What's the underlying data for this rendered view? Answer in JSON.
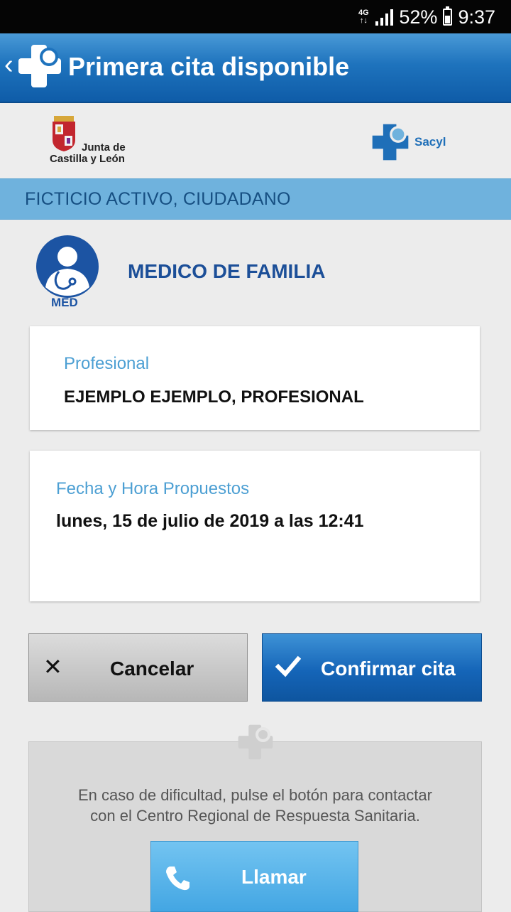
{
  "status_bar": {
    "network_top": "4G",
    "network_bottom": "↑↓",
    "battery_percent": "52%",
    "time": "9:37"
  },
  "app_bar": {
    "title": "Primera cita disponible",
    "back_icon": "chevron-left-icon",
    "logo_icon": "sacyl-cross-icon"
  },
  "logos": {
    "junta_line1": "Junta de",
    "junta_line2": "Castilla y León",
    "sacyl": "Sacyl"
  },
  "user": {
    "name": "FICTICIO ACTIVO, CIUDADANO"
  },
  "service": {
    "icon_label": "MED",
    "title": "MEDICO DE FAMILIA"
  },
  "professional": {
    "label": "Profesional",
    "value": "EJEMPLO EJEMPLO, PROFESIONAL"
  },
  "appointment": {
    "label": "Fecha y Hora Propuestos",
    "value": "lunes, 15 de julio de 2019 a las 12:41"
  },
  "actions": {
    "cancel_label": "Cancelar",
    "confirm_label": "Confirmar cita"
  },
  "help": {
    "line1": "En caso de dificultad, pulse el botón para contactar",
    "line2": "con el Centro Regional de Respuesta Sanitaria.",
    "call_label": "Llamar"
  },
  "colors": {
    "app_bar": "#1e73bd",
    "user_bar": "#6fb2dd",
    "accent_text": "#4c9fd3",
    "title_blue": "#1c4f98",
    "call_button": "#43a6e3"
  }
}
